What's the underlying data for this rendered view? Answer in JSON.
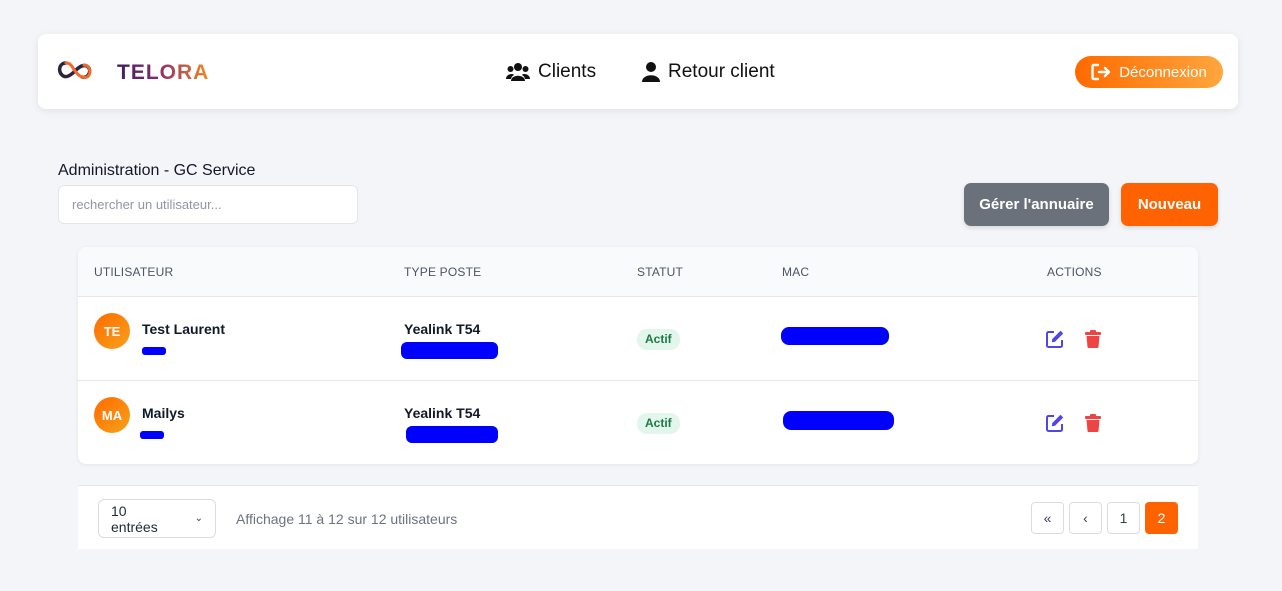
{
  "header": {
    "brand": "TELORA",
    "nav": [
      {
        "label": "Clients",
        "icon": "users-icon"
      },
      {
        "label": "Retour client",
        "icon": "user-icon"
      }
    ],
    "logout_label": "Déconnexion",
    "logout_icon": "sign-out-icon"
  },
  "admin": {
    "title": "Administration - GC Service",
    "search_placeholder": "rechercher un utilisateur...",
    "btn_annuaire": "Gérer l'annuaire",
    "btn_nouveau": "Nouveau"
  },
  "table": {
    "columns": [
      "UTILISATEUR",
      "TYPE POSTE",
      "STATUT",
      "MAC",
      "ACTIONS"
    ],
    "rows": [
      {
        "initials": "TE",
        "name": "Test Laurent",
        "poste": "Yealink T54",
        "status": "Actif"
      },
      {
        "initials": "MA",
        "name": "Mailys",
        "poste": "Yealink T54",
        "status": "Actif"
      }
    ]
  },
  "footer": {
    "page_size": "10 entrées",
    "info": "Affichage 11 à 12 sur 12 utilisateurs",
    "pager": [
      "«",
      "‹",
      "1",
      "2"
    ],
    "current_page": "2"
  },
  "colors": {
    "accent": "#ff6200",
    "secondary_button": "#6b717b",
    "status_badge_bg": "#e3f6ec",
    "status_badge_text": "#1c7a46",
    "edit_icon": "#4f46e5",
    "delete_icon": "#ef4444",
    "redaction": "#0000ff"
  }
}
